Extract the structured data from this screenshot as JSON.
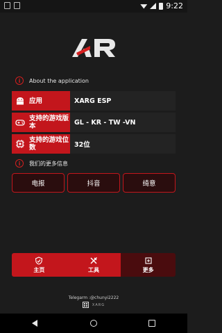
{
  "status_bar": {
    "time": "9:22"
  },
  "about": {
    "header": "About the application",
    "rows": [
      {
        "label": "应用",
        "value": "XARG ESP",
        "icon": "android-icon"
      },
      {
        "label": "支持的游戏版本",
        "value": "GL - KR - TW -VN",
        "icon": "gamepad-icon"
      },
      {
        "label": "支持的游戏位数",
        "value": "32位",
        "icon": "chip-icon"
      }
    ]
  },
  "more": {
    "header": "我们的更多信息",
    "buttons": [
      "电报",
      "抖音",
      "绮意"
    ]
  },
  "nav": {
    "items": [
      {
        "label": "主页",
        "icon": "shield-icon"
      },
      {
        "label": "工具",
        "icon": "tools-icon"
      },
      {
        "label": "更多",
        "icon": "more-icon"
      }
    ],
    "active_index": 2
  },
  "footer": {
    "telegram": "Telegarm :@chunyi2222",
    "brand": "XARG"
  },
  "colors": {
    "accent": "#c3161c",
    "background": "#1c1c1c"
  }
}
